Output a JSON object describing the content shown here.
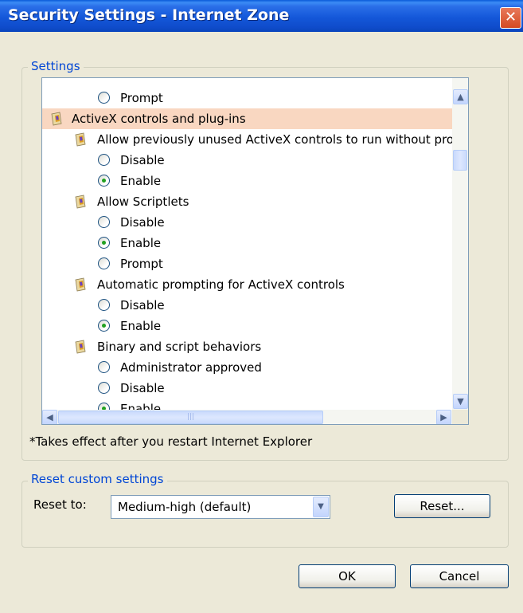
{
  "window": {
    "title": "Security Settings - Internet Zone",
    "close_glyph": "✕"
  },
  "settings_group": {
    "legend": "Settings",
    "tree_items": [
      {
        "kind": "radio",
        "label": "Prompt",
        "checked": false,
        "level": 2
      },
      {
        "kind": "category",
        "label": "ActiveX controls and plug-ins",
        "icon": "settings-shield-icon",
        "level": 0,
        "highlight": true
      },
      {
        "kind": "setting",
        "label": "Allow previously unused ActiveX controls to run without prom",
        "icon": "settings-shield-icon",
        "level": 1
      },
      {
        "kind": "radio",
        "label": "Disable",
        "checked": false,
        "level": 2
      },
      {
        "kind": "radio",
        "label": "Enable",
        "checked": true,
        "level": 2
      },
      {
        "kind": "setting",
        "label": "Allow Scriptlets",
        "icon": "settings-shield-icon",
        "level": 1
      },
      {
        "kind": "radio",
        "label": "Disable",
        "checked": false,
        "level": 2
      },
      {
        "kind": "radio",
        "label": "Enable",
        "checked": true,
        "level": 2
      },
      {
        "kind": "radio",
        "label": "Prompt",
        "checked": false,
        "level": 2
      },
      {
        "kind": "setting",
        "label": "Automatic prompting for ActiveX controls",
        "icon": "settings-shield-icon",
        "level": 1
      },
      {
        "kind": "radio",
        "label": "Disable",
        "checked": false,
        "level": 2
      },
      {
        "kind": "radio",
        "label": "Enable",
        "checked": true,
        "level": 2
      },
      {
        "kind": "setting",
        "label": "Binary and script behaviors",
        "icon": "settings-shield-icon",
        "level": 1
      },
      {
        "kind": "radio",
        "label": "Administrator approved",
        "checked": false,
        "level": 2
      },
      {
        "kind": "radio",
        "label": "Disable",
        "checked": false,
        "level": 2
      },
      {
        "kind": "radio",
        "label": "Enable",
        "checked": true,
        "level": 2
      }
    ],
    "scroll_up_glyph": "▲",
    "scroll_down_glyph": "▼",
    "scroll_left_glyph": "◀",
    "scroll_right_glyph": "▶",
    "grip_glyph": "|||",
    "restart_note": "*Takes effect after you restart Internet Explorer"
  },
  "reset_group": {
    "legend": "Reset custom settings",
    "reset_to_label": "Reset to:",
    "reset_level_value": "Medium-high (default)",
    "dropdown_glyph": "▼",
    "reset_button": "Reset..."
  },
  "footer": {
    "ok_button": "OK",
    "cancel_button": "Cancel"
  },
  "colors": {
    "dialog_bg": "#ECE9D8",
    "title_bar": "#1457D9",
    "group_legend": "#0046D5",
    "category_highlight": "#F9D7C1",
    "radio_checked_dot": "#21A121"
  }
}
